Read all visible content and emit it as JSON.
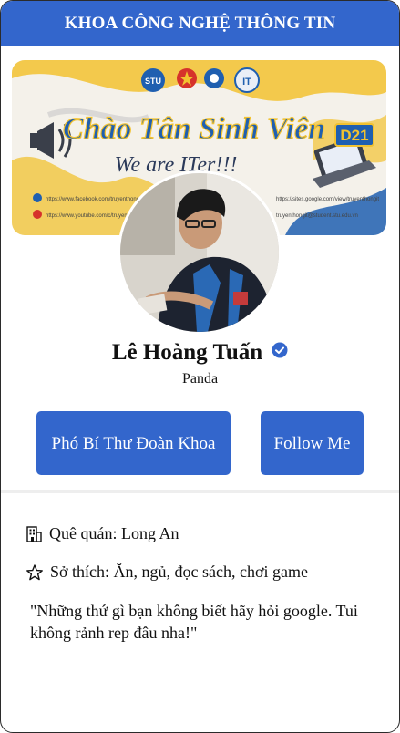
{
  "header": {
    "title": "KHOA CÔNG NGHỆ THÔNG TIN"
  },
  "banner": {
    "logos": [
      "STU",
      "IT"
    ],
    "headline": "Chào Tân Sinh Viên",
    "tagline": "We are ITer!!!",
    "badge": "D21",
    "links_left": [
      "https://www.facebook.com/truyenthongit",
      "https://www.youtube.com/c/truyenthong"
    ],
    "links_right": [
      "https://sites.google.com/view/truyenthongit",
      "truyenthongit@student.stu.edu.vn"
    ]
  },
  "profile": {
    "name": "Lê Hoàng Tuấn",
    "nickname": "Panda",
    "verified_icon": "verified-check-icon"
  },
  "buttons": {
    "role": "Phó Bí Thư Đoàn Khoa",
    "follow": "Follow Me"
  },
  "details": {
    "hometown": "Quê quán: Long An",
    "hobbies": "Sở thích: Ăn, ngủ, đọc sách, chơi game"
  },
  "quote": "\"Những thứ gì bạn không biết hãy hỏi google. Tui không rảnh rep đâu nha!\"",
  "colors": {
    "accent": "#3366cc",
    "banner_yellow": "#f2c230",
    "banner_blue": "#1f5fb0"
  }
}
